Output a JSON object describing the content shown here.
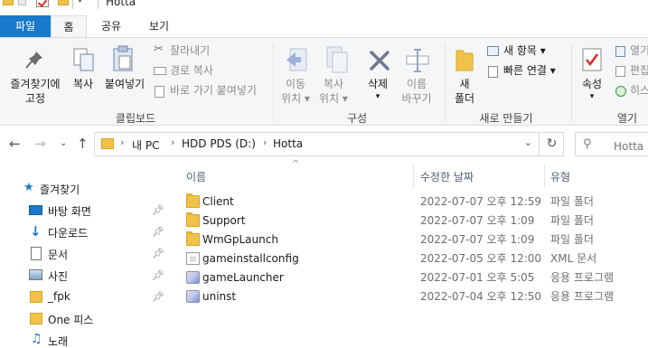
{
  "titlebar": {
    "title": "Hotta"
  },
  "tabs": {
    "file": "파일",
    "home": "홈",
    "share": "공유",
    "view": "보기"
  },
  "ribbon": {
    "clipboard": {
      "pin_to_quick_access": [
        "즐겨찾기에",
        "고정"
      ],
      "copy": "복사",
      "paste": "붙여넣기",
      "cut": "잘라내기",
      "copy_path": "경로 복사",
      "paste_shortcut": "바로 가기 붙여넣기",
      "group_label": "클립보드"
    },
    "organize": {
      "move_to": [
        "이동",
        "위치 ▾"
      ],
      "copy_to": [
        "복사",
        "위치 ▾"
      ],
      "delete": [
        "삭제",
        "▾"
      ],
      "rename": [
        "이름",
        "바꾸기"
      ],
      "group_label": "구성"
    },
    "new": {
      "new_folder": [
        "새",
        "폴더"
      ],
      "new_item": "새 항목 ▾",
      "easy_access": "빠른 연결 ▾",
      "group_label": "새로 만들기"
    },
    "open": {
      "properties": [
        "속성",
        "▾"
      ],
      "open": "열기",
      "edit": "편집",
      "history": "히스",
      "group_label": "열기"
    }
  },
  "address": {
    "crumbs": [
      "내 PC",
      "HDD PDS (D:)",
      "Hotta"
    ],
    "search_placeholder": "Hotta 검"
  },
  "navpane": {
    "items": [
      {
        "label": "즐겨찾기",
        "icon": "star-icon",
        "pinned": false
      },
      {
        "label": "바탕 화면",
        "icon": "desktop-icon",
        "pinned": true
      },
      {
        "label": "다운로드",
        "icon": "download-icon",
        "pinned": true
      },
      {
        "label": "문서",
        "icon": "document-icon",
        "pinned": true
      },
      {
        "label": "사진",
        "icon": "picture-icon",
        "pinned": true
      },
      {
        "label": "_fpk",
        "icon": "folder-icon",
        "pinned": true
      },
      {
        "label": "One 피스",
        "icon": "folder-icon",
        "pinned": false
      },
      {
        "label": "노래",
        "icon": "music-icon",
        "pinned": false
      }
    ]
  },
  "filelist": {
    "columns": {
      "name": "이름",
      "date": "수정한 날짜",
      "type": "유형"
    },
    "rows": [
      {
        "name": "Client",
        "date": "2022-07-07 오후 12:59",
        "type": "파일 폴더",
        "icon": "folder"
      },
      {
        "name": "Support",
        "date": "2022-07-07 오후 1:09",
        "type": "파일 폴더",
        "icon": "folder"
      },
      {
        "name": "WmGpLaunch",
        "date": "2022-07-07 오후 1:09",
        "type": "파일 폴더",
        "icon": "folder"
      },
      {
        "name": "gameinstallconfig",
        "date": "2022-07-05 오후 12:00",
        "type": "XML 문서",
        "icon": "xml"
      },
      {
        "name": "gameLauncher",
        "date": "2022-07-01 오후 5:05",
        "type": "응용 프로그램",
        "icon": "app"
      },
      {
        "name": "uninst",
        "date": "2022-07-04 오후 12:50",
        "type": "응용 프로그램",
        "icon": "app"
      }
    ]
  },
  "colors": {
    "file_tab": "#1979ca",
    "ribbon_bg": "#f5f6f7",
    "folder": "#f0c24a",
    "accent_blue": "#1979ca"
  }
}
